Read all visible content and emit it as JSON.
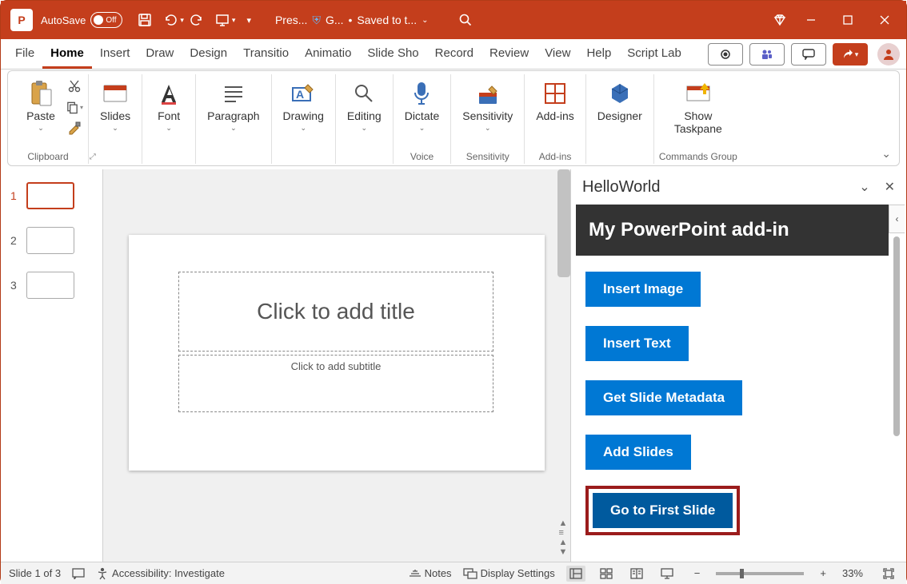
{
  "titlebar": {
    "autosave_label": "AutoSave",
    "autosave_toggle": "Off",
    "file_label": "Pres...",
    "account_label": "G...",
    "saved_label": "Saved to t..."
  },
  "tabs": [
    "File",
    "Home",
    "Insert",
    "Draw",
    "Design",
    "Transitions",
    "Animations",
    "Slide Show",
    "Record",
    "Review",
    "View",
    "Help",
    "Script Lab"
  ],
  "active_tab": "Home",
  "ribbon": {
    "paste": "Paste",
    "clipboard": "Clipboard",
    "slides": "Slides",
    "font": "Font",
    "paragraph": "Paragraph",
    "drawing": "Drawing",
    "editing": "Editing",
    "dictate": "Dictate",
    "voice": "Voice",
    "sensitivity": "Sensitivity",
    "sensitivity_grp": "Sensitivity",
    "addins": "Add-ins",
    "addins_grp": "Add-ins",
    "designer": "Designer",
    "show_taskpane": "Show\nTaskpane",
    "commands_group": "Commands Group"
  },
  "thumbnails": [
    1,
    2,
    3
  ],
  "slide": {
    "title_placeholder": "Click to add title",
    "subtitle_placeholder": "Click to add subtitle"
  },
  "taskpane": {
    "title": "HelloWorld",
    "banner": "My PowerPoint add-in",
    "buttons": [
      "Insert Image",
      "Insert Text",
      "Get Slide Metadata",
      "Add Slides",
      "Go to First Slide"
    ]
  },
  "statusbar": {
    "slide_info": "Slide 1 of 3",
    "accessibility": "Accessibility: Investigate",
    "notes": "Notes",
    "display_settings": "Display Settings",
    "zoom": "33%"
  }
}
